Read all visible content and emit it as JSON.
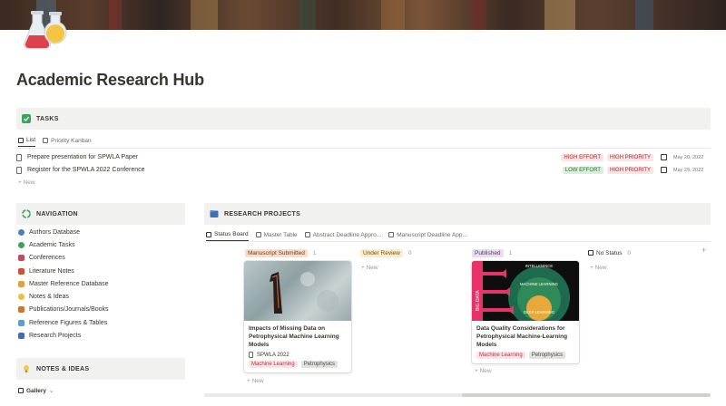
{
  "page": {
    "title": "Academic Research Hub"
  },
  "tasks": {
    "header": "TASKS",
    "tabs": [
      {
        "label": "List"
      },
      {
        "label": "Priority Kanban"
      }
    ],
    "items": [
      {
        "name": "Prepare presentation for SPWLA Paper",
        "effort": "HIGH EFFORT",
        "priority": "HIGH PRIORITY",
        "date": "May 20, 2022"
      },
      {
        "name": "Register for the SPWLA 2022 Conference",
        "effort": "LOW EFFORT",
        "priority": "HIGH PRIORITY",
        "date": "May 29, 2022"
      }
    ],
    "new_label": "+  New"
  },
  "navigation": {
    "header": "NAVIGATION",
    "items": [
      {
        "label": "Authors Database",
        "color": "#4a7fc1"
      },
      {
        "label": "Academic Tasks",
        "color": "#3aa55a"
      },
      {
        "label": "Conferences",
        "color": "#c04a6a"
      },
      {
        "label": "Literature Notes",
        "color": "#d0503a"
      },
      {
        "label": "Master Reference Database",
        "color": "#d9a441"
      },
      {
        "label": "Notes & Ideas",
        "color": "#e9c23a"
      },
      {
        "label": "Publications/Journals/Books",
        "color": "#c9782e"
      },
      {
        "label": "Reference Figures & Tables",
        "color": "#5a9fd4"
      },
      {
        "label": "Research Projects",
        "color": "#3f6fb5"
      }
    ]
  },
  "notes_ideas": {
    "header": "NOTES & IDEAS",
    "view_label": "Gallery"
  },
  "research": {
    "header": "RESEARCH PROJECTS",
    "tabs": [
      {
        "label": "Status Board"
      },
      {
        "label": "Master Table"
      },
      {
        "label": "Abstract Deadline Appro..."
      },
      {
        "label": "Manuscript Deadline App..."
      }
    ],
    "columns": [
      {
        "label": "Manuscript Submitted",
        "count": "1"
      },
      {
        "label": "Under Review",
        "count": "0"
      },
      {
        "label": "Published",
        "count": "1"
      },
      {
        "label": "No Status",
        "count": "0"
      }
    ],
    "cards": [
      {
        "title": "Impacts of Missing Data on Petrophysical Machine Learning Models",
        "conference": "SPWLA 2022",
        "tags": [
          "Machine Learning",
          "Petrophysics"
        ]
      },
      {
        "title": "Data Quality Considerations for Petrophysical Machine-Learning Models",
        "image_labels": [
          "INTELLIGENCE",
          "MACHINE LEARNING",
          "DEEP LEARNING",
          "BIG DATA"
        ],
        "tags": [
          "Machine Learning",
          "Petrophysics"
        ]
      }
    ],
    "new_label": "+  New",
    "add_label": "+"
  },
  "colors": {
    "callout_bg": "#f1f1ef",
    "tag_red": "#fbe4e4",
    "tag_green": "#dbeddb"
  }
}
